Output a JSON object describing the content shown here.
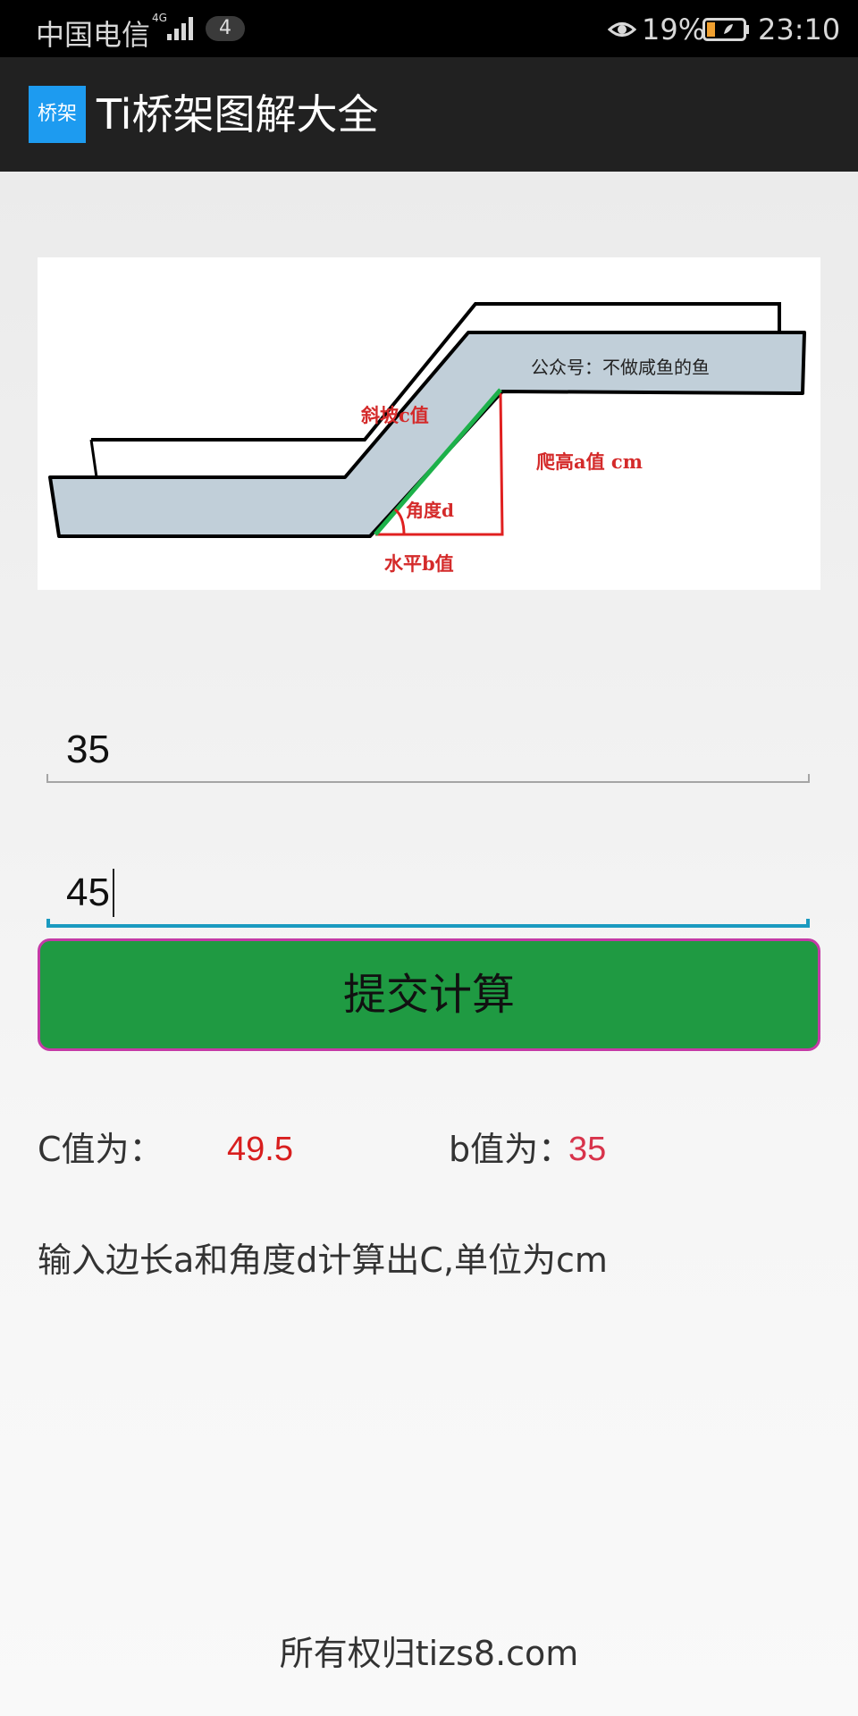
{
  "status_bar": {
    "carrier": "中国电信",
    "network_type": "4G",
    "notification_count": "4",
    "battery_percent": "19%",
    "time": "23:10",
    "icons": [
      "signal-icon",
      "eye-icon",
      "battery-icon"
    ]
  },
  "app_bar": {
    "logo_text": "桥架",
    "title": "Ti桥架图解大全",
    "logo_color": "#1d9bf0"
  },
  "diagram": {
    "watermark": "公众号：不做咸鱼的鱼",
    "label_c": "斜坡c值",
    "label_a": "爬高a值  cm",
    "label_angle": "角度d",
    "label_b": "水平b值"
  },
  "form": {
    "input_a_value": "35",
    "input_d_value": "45",
    "submit_label": "提交计算",
    "button_color": "#1f9a42"
  },
  "results": {
    "c_label": "C值为：",
    "c_value": "49.5",
    "b_label": "b值为：",
    "b_value": "35"
  },
  "hint": "输入边长a和角度d计算出C,单位为cm",
  "footer": "所有权归tizs8.com"
}
